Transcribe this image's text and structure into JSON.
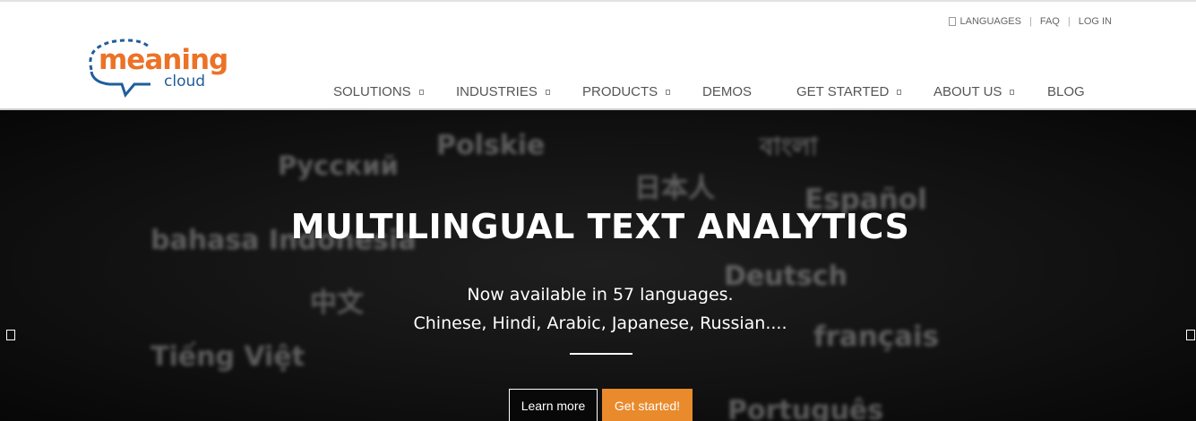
{
  "brand": {
    "word": "meaning",
    "sub": "cloud",
    "colors": {
      "orange": "#ec7227",
      "blue": "#1f5e9c",
      "accent_button": "#e98a2c"
    }
  },
  "utility_nav": [
    {
      "label": "LANGUAGES",
      "icon": "globe-icon"
    },
    {
      "label": "FAQ"
    },
    {
      "label": "LOG IN"
    }
  ],
  "main_nav": [
    {
      "label": "SOLUTIONS",
      "dropdown": true
    },
    {
      "label": "INDUSTRIES",
      "dropdown": true
    },
    {
      "label": "PRODUCTS",
      "dropdown": true
    },
    {
      "label": "DEMOS",
      "dropdown": false
    },
    {
      "label": "GET STARTED",
      "dropdown": true
    },
    {
      "label": "ABOUT US",
      "dropdown": true
    },
    {
      "label": "BLOG",
      "dropdown": false
    }
  ],
  "hero": {
    "title": "MULTILINGUAL TEXT ANALYTICS",
    "line1": "Now available in 57 languages.",
    "line2": "Chinese, Hindi, Arabic, Japanese, Russian....",
    "learn_more": "Learn more",
    "get_started": "Get started!",
    "background_words": [
      "Polskie",
      "Русский",
      "বাংলা",
      "日本人",
      "Español",
      "bahasa Indonesia",
      "中文",
      "Deutsch",
      "Tiếng Việt",
      "français",
      "Português"
    ]
  }
}
